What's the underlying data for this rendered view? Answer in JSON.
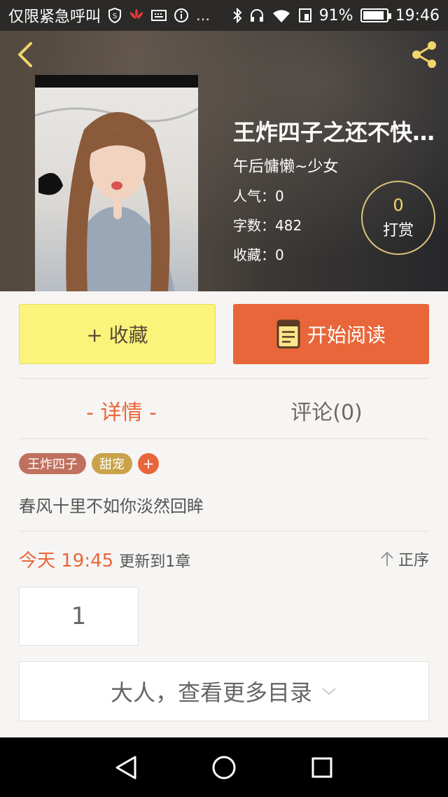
{
  "status_bar": {
    "carrier": "仅限紧急呼叫",
    "battery": "91%",
    "battery_level": 0.91,
    "time": "19:46",
    "icons": [
      "shield-icon",
      "huawei-icon",
      "keyboard-icon",
      "info-icon",
      "more-icon",
      "bluetooth-icon",
      "headphones-icon",
      "wifi-icon",
      "sim-icon",
      "battery-icon"
    ]
  },
  "header": {
    "back_icon": "chevron-left-icon",
    "share_icon": "share-icon",
    "accent_color": "#f1d66b"
  },
  "book": {
    "title": "王炸四子之还不快…",
    "author": "午后慵懒~少女",
    "popularity": "人气：0",
    "word_count": "字数：482",
    "favorites": "收藏：0",
    "reward_count": "0",
    "reward_label": "打赏"
  },
  "actions": {
    "collect_label": "+ 收藏",
    "read_label": "开始阅读",
    "collect_color": "#fbf37a",
    "read_color": "#e8663a"
  },
  "tabs": {
    "detail_label": "- 详情 -",
    "comment_label": "评论(0)"
  },
  "tags": [
    "王炸四子",
    "甜宠"
  ],
  "tag_add_label": "+",
  "intro": "春风十里不如你淡然回眸",
  "update": {
    "time": "今天 19:45",
    "text": "更新到1章",
    "sort_label": "正序"
  },
  "chapters": [
    "1"
  ],
  "more_label": "大人，查看更多目录",
  "nav": {
    "icons": [
      "back-triangle-icon",
      "home-circle-icon",
      "recents-square-icon"
    ]
  }
}
